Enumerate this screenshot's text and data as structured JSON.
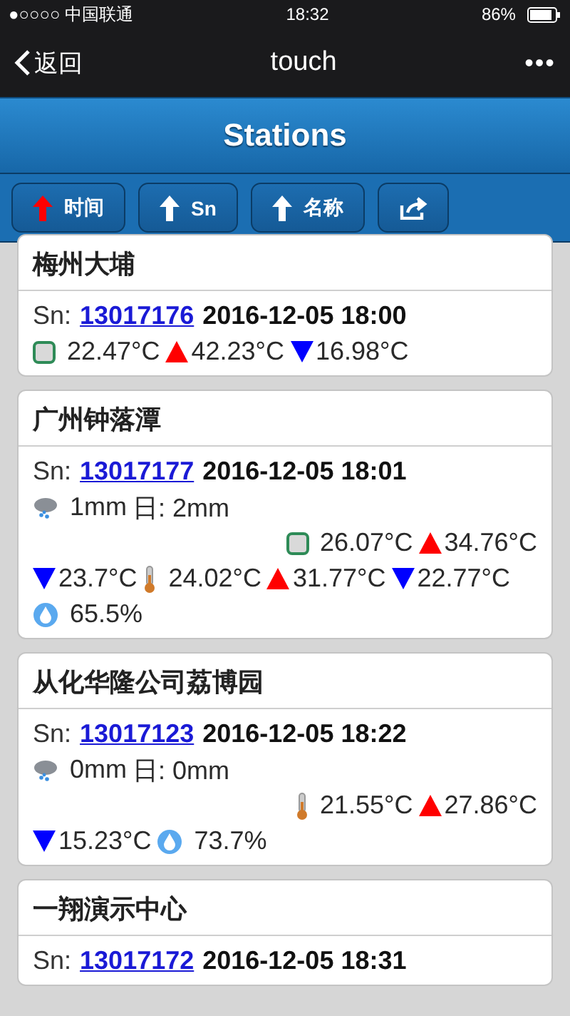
{
  "status_bar": {
    "carrier": "●○○○○ 中国联通",
    "time": "18:32",
    "battery": "86%"
  },
  "nav": {
    "back": "返回",
    "title": "touch",
    "more": "•••"
  },
  "header": {
    "title": "Stations"
  },
  "toolbar": [
    {
      "kind": "sort",
      "label": "时间",
      "selected": true
    },
    {
      "kind": "sort",
      "label": "Sn",
      "selected": false
    },
    {
      "kind": "sort",
      "label": "名称",
      "selected": false
    },
    {
      "kind": "share"
    }
  ],
  "stations": [
    {
      "name": "梅州大埔",
      "sn_label": "Sn:",
      "sn": "13017176",
      "time": "2016-12-05 18:00",
      "lines": [
        [
          {
            "kind": "soil",
            "value": "22.47°C"
          },
          {
            "kind": "max",
            "value": "42.23°C"
          },
          {
            "kind": "min",
            "value": "16.98°C"
          }
        ]
      ]
    },
    {
      "name": "广州钟落潭",
      "sn_label": "Sn:",
      "sn": "13017177",
      "time": "2016-12-05 18:01",
      "lines": [
        [
          {
            "kind": "rain",
            "value": "1mm"
          },
          {
            "kind": "text",
            "value": "日: 2mm"
          }
        ],
        [
          {
            "kind": "soil",
            "value": "26.07°C"
          },
          {
            "kind": "max",
            "value": "34.76°C"
          }
        ],
        [
          {
            "kind": "min",
            "value": "23.7°C"
          },
          {
            "kind": "temp",
            "value": "24.02°C"
          },
          {
            "kind": "max",
            "value": "31.77°C"
          },
          {
            "kind": "min",
            "value": "22.77°C"
          }
        ],
        [
          {
            "kind": "humidity",
            "value": "65.5%"
          }
        ]
      ]
    },
    {
      "name": "从化华隆公司荔博园",
      "sn_label": "Sn:",
      "sn": "13017123",
      "time": "2016-12-05 18:22",
      "lines": [
        [
          {
            "kind": "rain",
            "value": "0mm"
          },
          {
            "kind": "text",
            "value": "日: 0mm"
          }
        ],
        [
          {
            "kind": "temp",
            "value": "21.55°C"
          },
          {
            "kind": "max",
            "value": "27.86°C"
          }
        ],
        [
          {
            "kind": "min",
            "value": "15.23°C"
          },
          {
            "kind": "humidity",
            "value": "73.7%"
          }
        ]
      ]
    },
    {
      "name": "一翔演示中心",
      "sn_label": "Sn:",
      "sn": "13017172",
      "time": "2016-12-05 18:31"
    }
  ]
}
